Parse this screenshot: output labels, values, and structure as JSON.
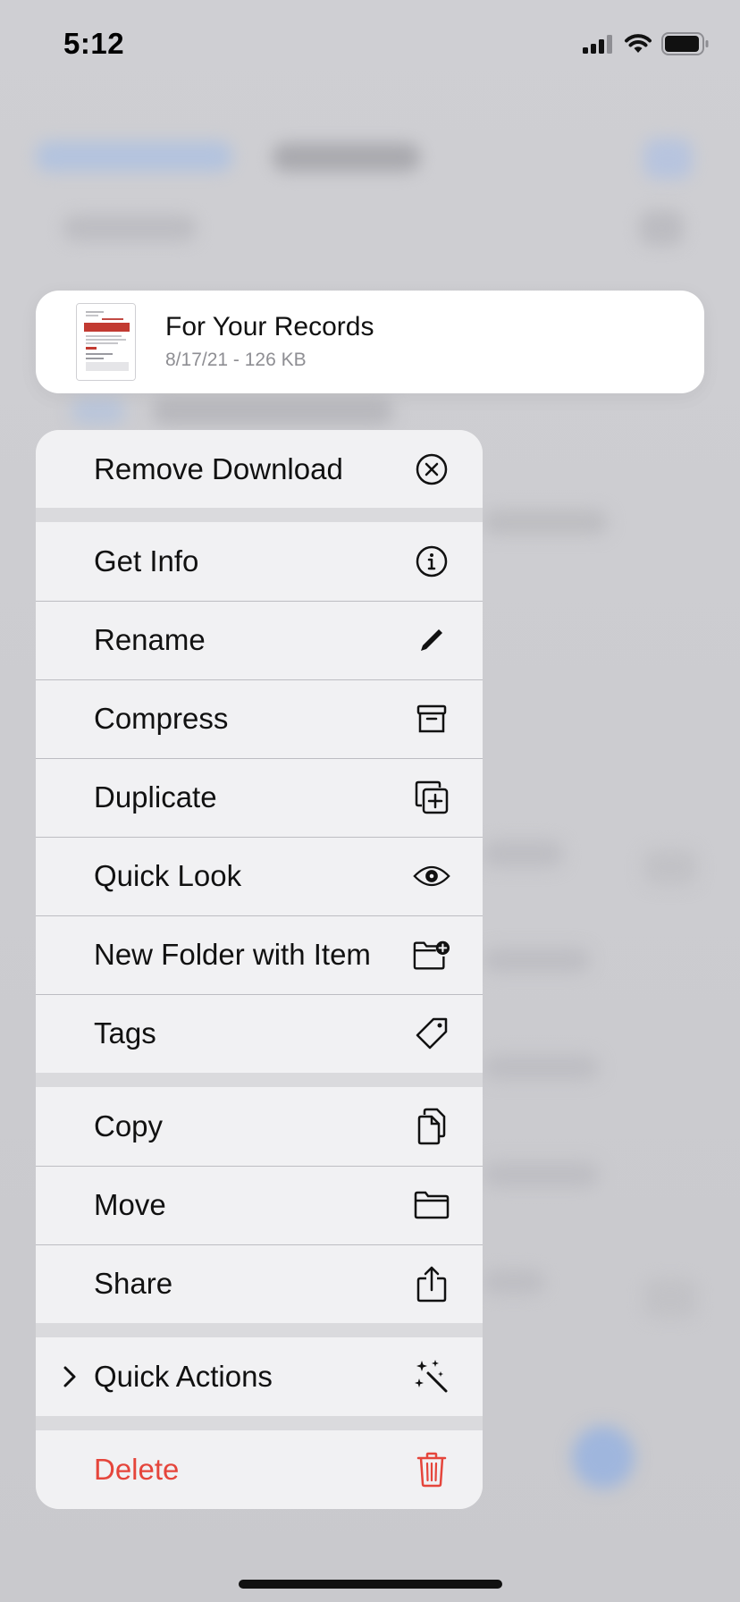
{
  "status_bar": {
    "time": "5:12"
  },
  "preview": {
    "title": "For Your Records",
    "meta": "8/17/21 - 126 KB"
  },
  "menu": {
    "remove_download": {
      "label": "Remove Download",
      "icon": "xmark-circle-icon"
    },
    "get_info": {
      "label": "Get Info",
      "icon": "info-circle-icon"
    },
    "rename": {
      "label": "Rename",
      "icon": "pencil-icon"
    },
    "compress": {
      "label": "Compress",
      "icon": "archivebox-icon"
    },
    "duplicate": {
      "label": "Duplicate",
      "icon": "plus-square-on-square-icon"
    },
    "quick_look": {
      "label": "Quick Look",
      "icon": "eye-icon"
    },
    "new_folder": {
      "label": "New Folder with Item",
      "icon": "folder-badge-plus-icon"
    },
    "tags": {
      "label": "Tags",
      "icon": "tag-icon"
    },
    "copy": {
      "label": "Copy",
      "icon": "doc-on-doc-icon"
    },
    "move": {
      "label": "Move",
      "icon": "folder-icon"
    },
    "share": {
      "label": "Share",
      "icon": "square-and-arrow-up-icon"
    },
    "quick_actions": {
      "label": "Quick Actions",
      "icon": "wand-and-stars-icon"
    },
    "delete": {
      "label": "Delete",
      "icon": "trash-icon"
    }
  },
  "colors": {
    "destructive": "#e5453b",
    "menu_background": "#f1f1f3",
    "separator": "#bdbdc2"
  }
}
